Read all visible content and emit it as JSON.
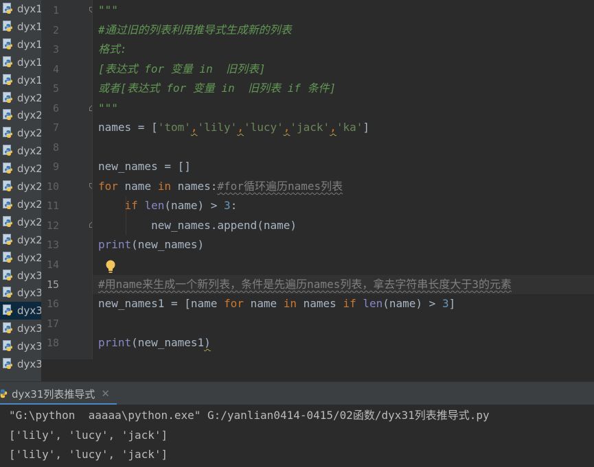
{
  "project_tree": {
    "items": [
      {
        "label": "dyx1"
      },
      {
        "label": "dyx1"
      },
      {
        "label": "dyx1"
      },
      {
        "label": "dyx1"
      },
      {
        "label": "dyx1"
      },
      {
        "label": "dyx2"
      },
      {
        "label": "dyx2"
      },
      {
        "label": "dyx2"
      },
      {
        "label": "dyx2"
      },
      {
        "label": "dyx2"
      },
      {
        "label": "dyx2"
      },
      {
        "label": "dyx2"
      },
      {
        "label": "dyx2"
      },
      {
        "label": "dyx2"
      },
      {
        "label": "dyx2"
      },
      {
        "label": "dyx3"
      },
      {
        "label": "dyx3"
      },
      {
        "label": "dyx3"
      },
      {
        "label": "dyx3"
      },
      {
        "label": "dyx3"
      },
      {
        "label": "dyx3"
      }
    ],
    "selected_index": 17,
    "icon": "python-file-icon"
  },
  "editor": {
    "line_numbers": [
      "1",
      "2",
      "3",
      "4",
      "5",
      "6",
      "7",
      "8",
      "9",
      "10",
      "11",
      "12",
      "13",
      "14",
      "15",
      "16",
      "17",
      "18"
    ],
    "current_line": "15",
    "l1": {
      "doc": "\"\"\""
    },
    "l2": {
      "doc": "#通过旧的列表利用推导式生成新的列表"
    },
    "l3": {
      "doc": "格式:"
    },
    "l4": {
      "doc": "[表达式 for 变量 in  旧列表]"
    },
    "l5": {
      "doc": "或者[表达式 for 变量 in  旧列表 if 条件]"
    },
    "l6": {
      "doc": "\"\"\""
    },
    "l7": {
      "a": "names = [",
      "s1": "'tom'",
      "c1": ",",
      "s2": "'lily'",
      "c2": ",",
      "s3": "'lucy'",
      "c3": ",",
      "s4": "'jack'",
      "c4": ",",
      "s5": "'ka'",
      "b": "]"
    },
    "l9": {
      "text": "new_names = []"
    },
    "l10": {
      "kw1": "for",
      "t1": " name ",
      "kw2": "in",
      "t2": " names:",
      "comment": "#for循环遍历names列表"
    },
    "l11": {
      "indent": "    ",
      "kw": "if",
      "t1": " ",
      "bi": "len",
      "t2": "(name) > ",
      "num": "3",
      "t3": ":"
    },
    "l12": {
      "indent": "        ",
      "text": "new_names.append(name)"
    },
    "l13": {
      "bi": "print",
      "t": "(new_names)"
    },
    "l15": {
      "comment": "#用name来生成一个新列表，条件是先遍历names列表，拿去字符串长度大于3的元素"
    },
    "l16": {
      "t1": "new_names1 = [name ",
      "kw1": "for",
      "t2": " name ",
      "kw2": "in",
      "t3": " names ",
      "kw3": "if",
      "t4": " ",
      "bi": "len",
      "t5": "(name) > ",
      "num": "3",
      "t6": "]"
    },
    "l18": {
      "bi": "print",
      "t": "(new_names1",
      "close": ")"
    }
  },
  "run_panel": {
    "tab_label": "dyx31列表推导式",
    "close_icon": "close-icon",
    "output": [
      "\"G:\\python  aaaaa\\python.exe\" G:/yanlian0414-0415/02函数/dyx31列表推导式.py",
      "['lily', 'lucy', 'jack']",
      "['lily', 'lucy', 'jack']"
    ]
  },
  "colors": {
    "editor_bg": "#2b2b2b",
    "keyword": "#cc7832",
    "string": "#6a8759",
    "docstring": "#629755",
    "builtin": "#8888c6",
    "number": "#6897bb",
    "comment": "#808080"
  }
}
